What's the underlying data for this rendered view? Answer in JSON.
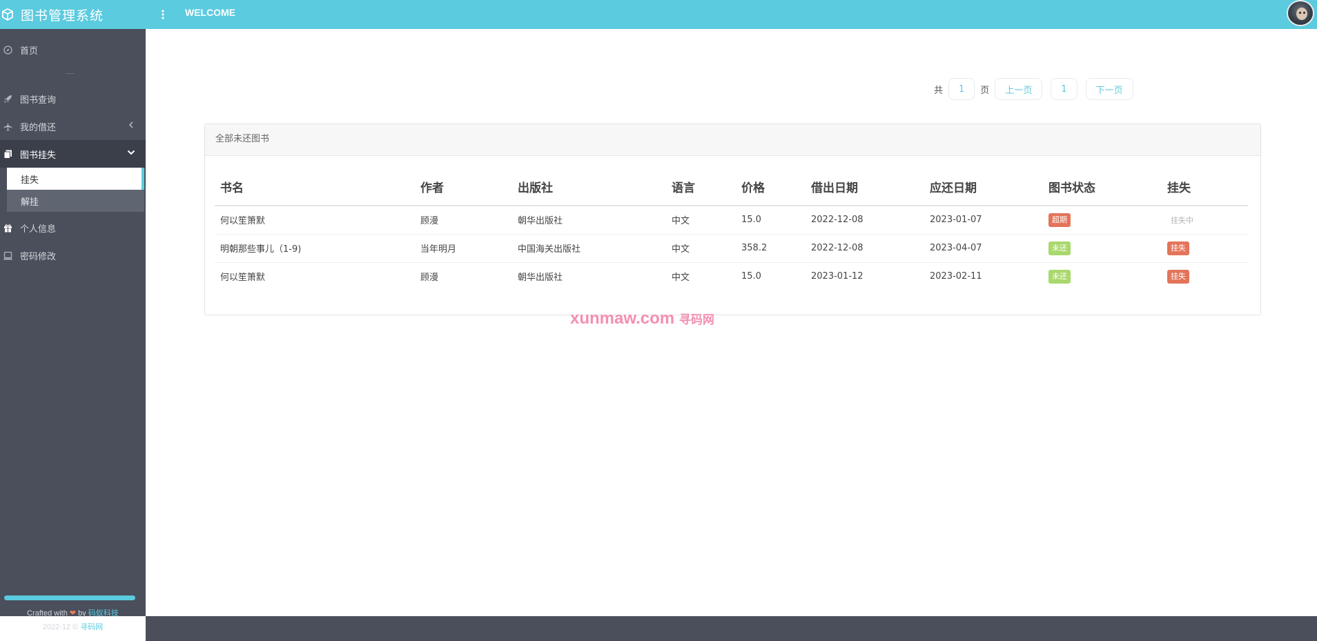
{
  "header": {
    "brand_title": "图书管理系统",
    "welcome": "WELCOME",
    "brand_icon": "cube-icon",
    "menu_icon": "kebab-menu-icon",
    "accent_color": "#5bcbdf"
  },
  "sidebar": {
    "items": [
      {
        "label": "首页",
        "icon": "compass-icon"
      },
      {
        "label": "图书查询",
        "icon": "rocket-icon"
      },
      {
        "label": "我的借还",
        "icon": "plane-icon"
      },
      {
        "label": "图书挂失",
        "icon": "copy-icon"
      },
      {
        "label": "个人信息",
        "icon": "gift-icon"
      },
      {
        "label": "密码修改",
        "icon": "laptop-icon"
      }
    ],
    "sub_items": [
      {
        "label": "挂失"
      },
      {
        "label": "解挂"
      }
    ],
    "credits": {
      "crafted": "Crafted with",
      "by": "by",
      "author": "码蚁科技",
      "date": "2022-12 ©",
      "site": "寻码网"
    }
  },
  "pager": {
    "total_prefix": "共",
    "total_pages": "1",
    "total_suffix": "页",
    "prev": "上一页",
    "current": "1",
    "next": "下一页"
  },
  "panel": {
    "title": "全部未还图书",
    "columns": [
      "书名",
      "作者",
      "出版社",
      "语言",
      "价格",
      "借出日期",
      "应还日期",
      "图书状态",
      "挂失"
    ],
    "rows": [
      {
        "title": "何以笙箫默",
        "author": "顾漫",
        "publisher": "朝华出版社",
        "language": "中文",
        "price": "15.0",
        "borrow_date": "2022-12-08",
        "due_date": "2023-01-07",
        "status": "超期",
        "status_color": "#e3745a",
        "loss": "挂失中",
        "loss_is_button": false
      },
      {
        "title": "明朝那些事儿（1-9)",
        "author": "当年明月",
        "publisher": "中国海关出版社",
        "language": "中文",
        "price": "358.2",
        "borrow_date": "2022-12-08",
        "due_date": "2023-04-07",
        "status": "未还",
        "status_color": "#a9d86c",
        "loss": "挂失",
        "loss_is_button": true
      },
      {
        "title": "何以笙箫默",
        "author": "顾漫",
        "publisher": "朝华出版社",
        "language": "中文",
        "price": "15.0",
        "borrow_date": "2023-01-12",
        "due_date": "2023-02-11",
        "status": "未还",
        "status_color": "#a9d86c",
        "loss": "挂失",
        "loss_is_button": true
      }
    ]
  },
  "watermark": {
    "domain": "xunmaw.com",
    "cn": "寻码网"
  }
}
